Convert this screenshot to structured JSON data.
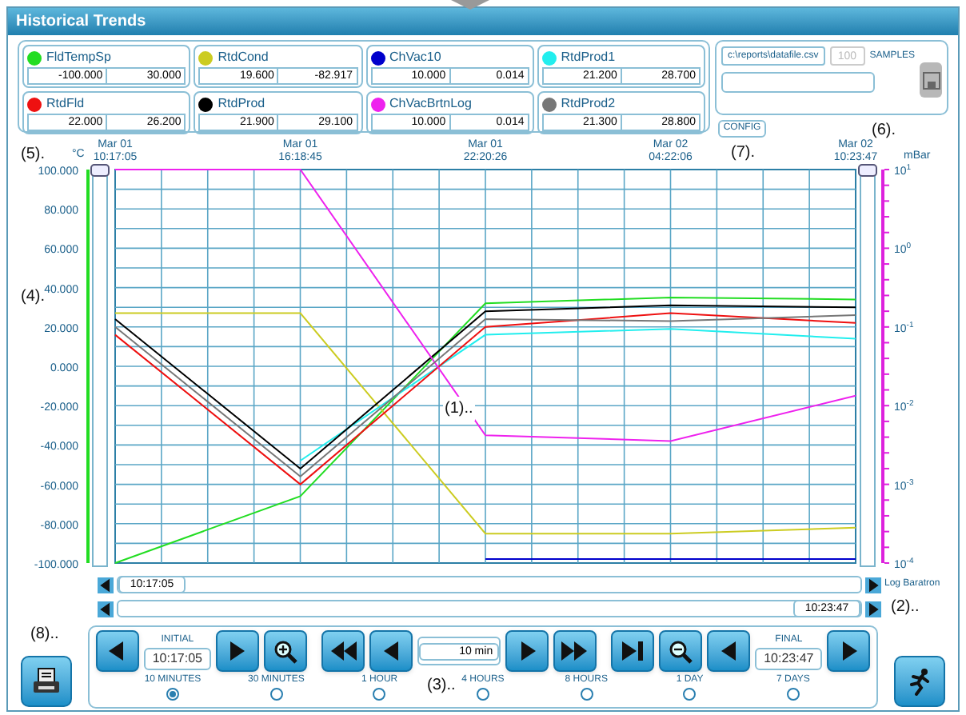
{
  "window": {
    "title": "Historical Trends"
  },
  "tags": [
    {
      "min": "-100.000",
      "max": "30.000"
    },
    {
      "min": "19.600",
      "max": "-82.917"
    },
    {
      "min": "10.000",
      "max": "0.014"
    },
    {
      "min": "21.200",
      "max": "28.700"
    },
    {
      "min": "22.000",
      "max": "26.200"
    },
    {
      "min": "21.900",
      "max": "29.100"
    },
    {
      "min": "10.000",
      "max": "0.014"
    },
    {
      "min": "21.300",
      "max": "28.800"
    }
  ],
  "export": {
    "path": "c:\\reports\\datafile.csv",
    "samples": {
      "placeholder": "100"
    },
    "samples_label": "SAMPLES",
    "save_button": {
      "disabled": true
    }
  },
  "config_button": "CONFIG",
  "callouts": {
    "chart_center": "(1)..",
    "scroll_right": "(2)..",
    "controls": "(3)..",
    "left_axis": "(4).",
    "axis_unit": "(5).",
    "panel_right": "(6).",
    "config": "(7).",
    "print": "(8).."
  },
  "chart": {
    "left_unit": "°C",
    "right_unit": "mBar",
    "right_ticks": [
      "10$^{1}$",
      "10$^{0}$",
      "10$^{-1}$",
      "10$^{-2}$",
      "10$^{-3}$",
      "10$^{-4}$"
    ],
    "tick_dates": [
      "Mar 01",
      "Mar 01",
      "Mar 01",
      "Mar 02",
      "Mar 02"
    ],
    "chart_data": {
      "type": "line",
      "grid": true,
      "categories": [
        "10:17:05",
        "16:18:45",
        "22:20:26",
        "04:22:06",
        "10:23:47"
      ],
      "ylim": [
        -100,
        100
      ],
      "yticks": [
        {
          "value": 100,
          "label": "100.000"
        },
        {
          "value": 80,
          "label": "80.000"
        },
        {
          "value": 60,
          "label": "60.000"
        },
        {
          "value": 40,
          "label": "40.000"
        },
        {
          "value": 20,
          "label": "20.000"
        },
        {
          "value": 0,
          "label": "0.000"
        },
        {
          "value": -20,
          "label": "-20.000"
        },
        {
          "value": -40,
          "label": "-40.000"
        },
        {
          "value": -60,
          "label": "-60.000"
        },
        {
          "value": -80,
          "label": "-80.000"
        },
        {
          "value": -100,
          "label": "-100.000"
        }
      ],
      "series": [
        {
          "name": "FldTempSp",
          "color": "#22dd22",
          "values": [
            -100,
            -66,
            32,
            35,
            34
          ]
        },
        {
          "name": "RtdCond",
          "color": "#cccc22",
          "values": [
            27,
            27,
            -85,
            -85,
            -82
          ]
        },
        {
          "name": "ChVac10",
          "color": "#0000cc",
          "values": [
            null,
            null,
            -98,
            -98,
            -98
          ]
        },
        {
          "name": "RtdProd1",
          "color": "#22eeee",
          "values": [
            null,
            -48,
            16,
            19,
            14
          ]
        },
        {
          "name": "RtdFld",
          "color": "#ee1111",
          "values": [
            16,
            -60,
            20,
            27,
            22
          ]
        },
        {
          "name": "RtdProd",
          "color": "#000000",
          "values": [
            24,
            -52,
            28,
            31,
            30
          ]
        },
        {
          "name": "ChVacBrtnLog",
          "color": "#ee22ee",
          "values": [
            100,
            100,
            -35,
            -38,
            -15
          ]
        },
        {
          "name": "RtdProd2",
          "color": "#777777",
          "values": [
            20,
            -56,
            24,
            23,
            26
          ]
        }
      ]
    }
  },
  "scrollbars": [
    {
      "value": "10:17:05",
      "kind": "start",
      "label": "Log Baratron"
    },
    {
      "value": "10:23:47",
      "kind": "end"
    }
  ],
  "controls": {
    "initial": {
      "label": "INITIAL",
      "value": "10:17:05"
    },
    "span": "10 min",
    "final": {
      "label": "FINAL",
      "value": "10:23:47"
    },
    "ranges": [
      {
        "label": "10 MINUTES",
        "selected": true
      },
      {
        "label": "30 MINUTES",
        "selected": false
      },
      {
        "label": "1 HOUR",
        "selected": false
      },
      {
        "label": "4 HOURS",
        "selected": false
      },
      {
        "label": "8 HOURS",
        "selected": false
      },
      {
        "label": "1 DAY",
        "selected": false
      },
      {
        "label": "7 DAYS",
        "selected": false
      }
    ]
  }
}
